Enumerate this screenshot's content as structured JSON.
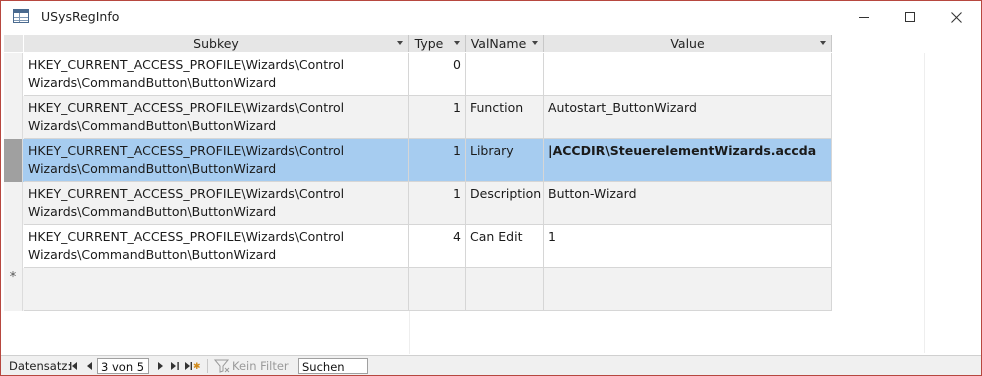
{
  "window": {
    "title": "USysRegInfo",
    "minimize_icon": "minimize-icon",
    "maximize_icon": "maximize-icon",
    "close_icon": "close-icon"
  },
  "table": {
    "columns": [
      {
        "key": "subkey",
        "label": "Subkey"
      },
      {
        "key": "type",
        "label": "Type"
      },
      {
        "key": "valname",
        "label": "ValName"
      },
      {
        "key": "value",
        "label": "Value"
      }
    ],
    "rows": [
      {
        "subkey": "HKEY_CURRENT_ACCESS_PROFILE\\Wizards\\Control Wizards\\CommandButton\\ButtonWizard",
        "type": "0",
        "valname": "",
        "value": ""
      },
      {
        "subkey": "HKEY_CURRENT_ACCESS_PROFILE\\Wizards\\Control Wizards\\CommandButton\\ButtonWizard",
        "type": "1",
        "valname": "Function",
        "value": "Autostart_ButtonWizard"
      },
      {
        "subkey": "HKEY_CURRENT_ACCESS_PROFILE\\Wizards\\Control Wizards\\CommandButton\\ButtonWizard",
        "type": "1",
        "valname": "Library",
        "value": "|ACCDIR\\SteuerelementWizards.accda"
      },
      {
        "subkey": "HKEY_CURRENT_ACCESS_PROFILE\\Wizards\\Control Wizards\\CommandButton\\ButtonWizard",
        "type": "1",
        "valname": "Description",
        "value": "Button-Wizard"
      },
      {
        "subkey": "HKEY_CURRENT_ACCESS_PROFILE\\Wizards\\Control Wizards\\CommandButton\\ButtonWizard",
        "type": "4",
        "valname": "Can Edit",
        "value": "1"
      }
    ],
    "selected_row_index": 2,
    "new_row_marker": "*"
  },
  "navigation": {
    "label": "Datensatz:",
    "record_position": "3 von 5",
    "first_icon": "first-record-icon",
    "prev_icon": "previous-record-icon",
    "next_icon": "next-record-icon",
    "last_icon": "last-record-icon",
    "new_icon": "new-record-icon",
    "filter_label": "Kein Filter",
    "filter_icon": "filter-icon",
    "search_value": "Suchen"
  }
}
